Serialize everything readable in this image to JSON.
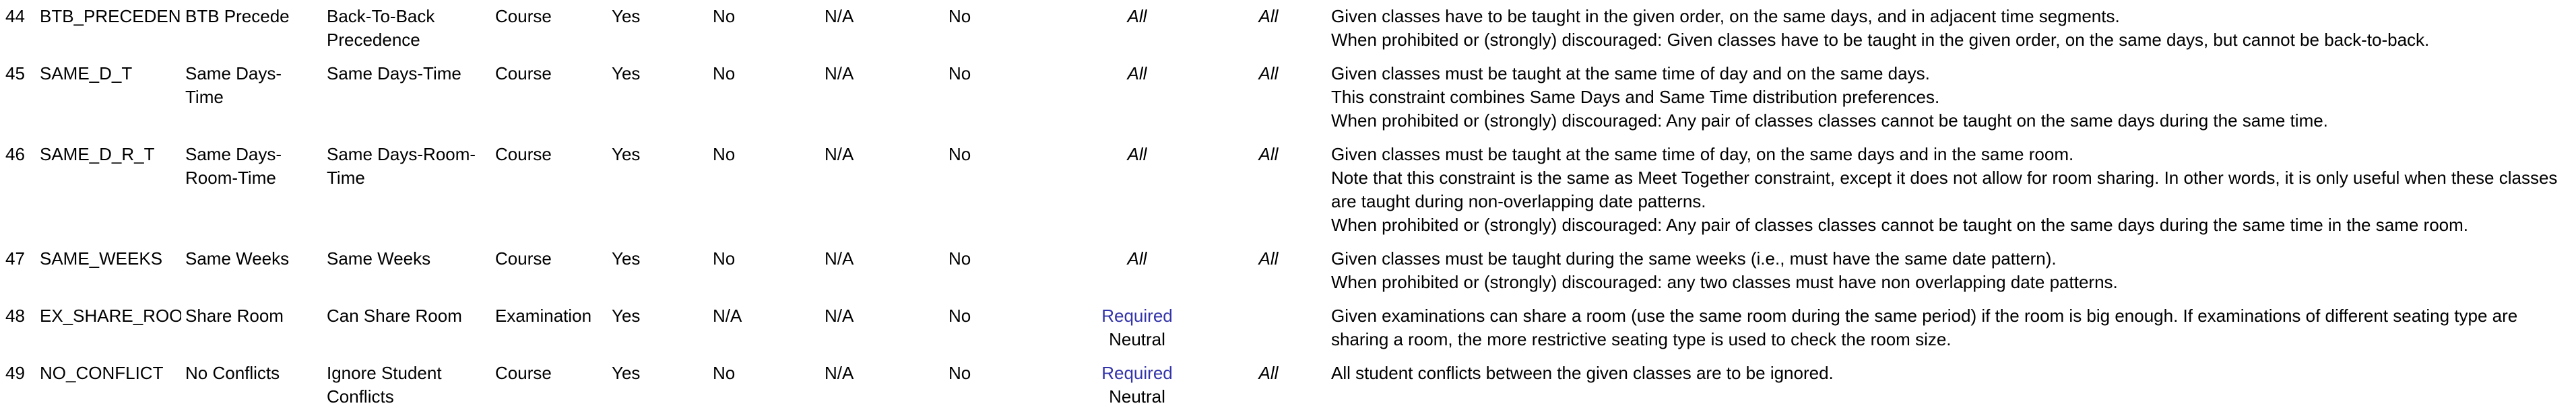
{
  "colors": {
    "text": "#000000",
    "required_link": "#3333aa",
    "background": "#ffffff"
  },
  "rows": [
    {
      "id": "44",
      "reference": "BTB_PRECEDENCE",
      "abbreviation": "BTB Precede",
      "name": "Back-To-Back Precedence",
      "type": "Course",
      "allow_required": "Yes",
      "allow_soft": "No",
      "allow_prohibited": "N/A",
      "visible": "No",
      "instructor_pref": "",
      "instructor_pref_sub": "",
      "instructor_pref_all": "All",
      "exam_pref": "All",
      "description": [
        "Given classes have to be taught in the given order, on the same days, and in adjacent time segments.",
        "When prohibited or (strongly) discouraged: Given classes have to be taught in the given order, on the same days, but cannot be back-to-back."
      ]
    },
    {
      "id": "45",
      "reference": "SAME_D_T",
      "abbreviation": "Same Days-Time",
      "name": "Same Days-Time",
      "type": "Course",
      "allow_required": "Yes",
      "allow_soft": "No",
      "allow_prohibited": "N/A",
      "visible": "No",
      "instructor_pref": "",
      "instructor_pref_sub": "",
      "instructor_pref_all": "All",
      "exam_pref": "All",
      "description": [
        "Given classes must be taught at the same time of day and on the same days.",
        "This constraint combines Same Days and Same Time distribution preferences.",
        "When prohibited or (strongly) discouraged: Any pair of classes classes cannot be taught on the same days during the same time."
      ]
    },
    {
      "id": "46",
      "reference": "SAME_D_R_T",
      "abbreviation": "Same Days-Room-Time",
      "name": "Same Days-Room-Time",
      "type": "Course",
      "allow_required": "Yes",
      "allow_soft": "No",
      "allow_prohibited": "N/A",
      "visible": "No",
      "instructor_pref": "",
      "instructor_pref_sub": "",
      "instructor_pref_all": "All",
      "exam_pref": "All",
      "description": [
        "Given classes must be taught at the same time of day, on the same days and in the same room.",
        "Note that this constraint is the same as Meet Together constraint, except it does not allow for room sharing. In other words, it is only useful when these classes are taught during non-overlapping date patterns.",
        "When prohibited or (strongly) discouraged: Any pair of classes classes cannot be taught on the same days during the same time in the same room."
      ]
    },
    {
      "id": "47",
      "reference": "SAME_WEEKS",
      "abbreviation": "Same Weeks",
      "name": "Same Weeks",
      "type": "Course",
      "allow_required": "Yes",
      "allow_soft": "No",
      "allow_prohibited": "N/A",
      "visible": "No",
      "instructor_pref": "",
      "instructor_pref_sub": "",
      "instructor_pref_all": "All",
      "exam_pref": "All",
      "description": [
        "Given classes must be taught during the same weeks (i.e., must have the same date pattern).",
        "When prohibited or (strongly) discouraged: any two classes must have non overlapping date patterns."
      ]
    },
    {
      "id": "48",
      "reference": "EX_SHARE_ROOM",
      "abbreviation": "Share Room",
      "name": "Can Share Room",
      "type": "Examination",
      "allow_required": "Yes",
      "allow_soft": "N/A",
      "allow_prohibited": "N/A",
      "visible": "No",
      "instructor_pref": "Required",
      "instructor_pref_sub": "Neutral",
      "instructor_pref_all": "",
      "exam_pref": "",
      "description": [
        "Given examinations can share a room (use the same room during the same period) if the room is big enough. If examinations of different seating type are sharing a room, the more restrictive seating type is used to check the room size."
      ]
    },
    {
      "id": "49",
      "reference": "NO_CONFLICT",
      "abbreviation": "No Conflicts",
      "name": "Ignore Student Conflicts",
      "type": "Course",
      "allow_required": "Yes",
      "allow_soft": "No",
      "allow_prohibited": "N/A",
      "visible": "No",
      "instructor_pref": "Required",
      "instructor_pref_sub": "Neutral",
      "instructor_pref_all": "",
      "exam_pref": "All",
      "description": [
        "All student conflicts between the given classes are to be ignored."
      ]
    }
  ]
}
